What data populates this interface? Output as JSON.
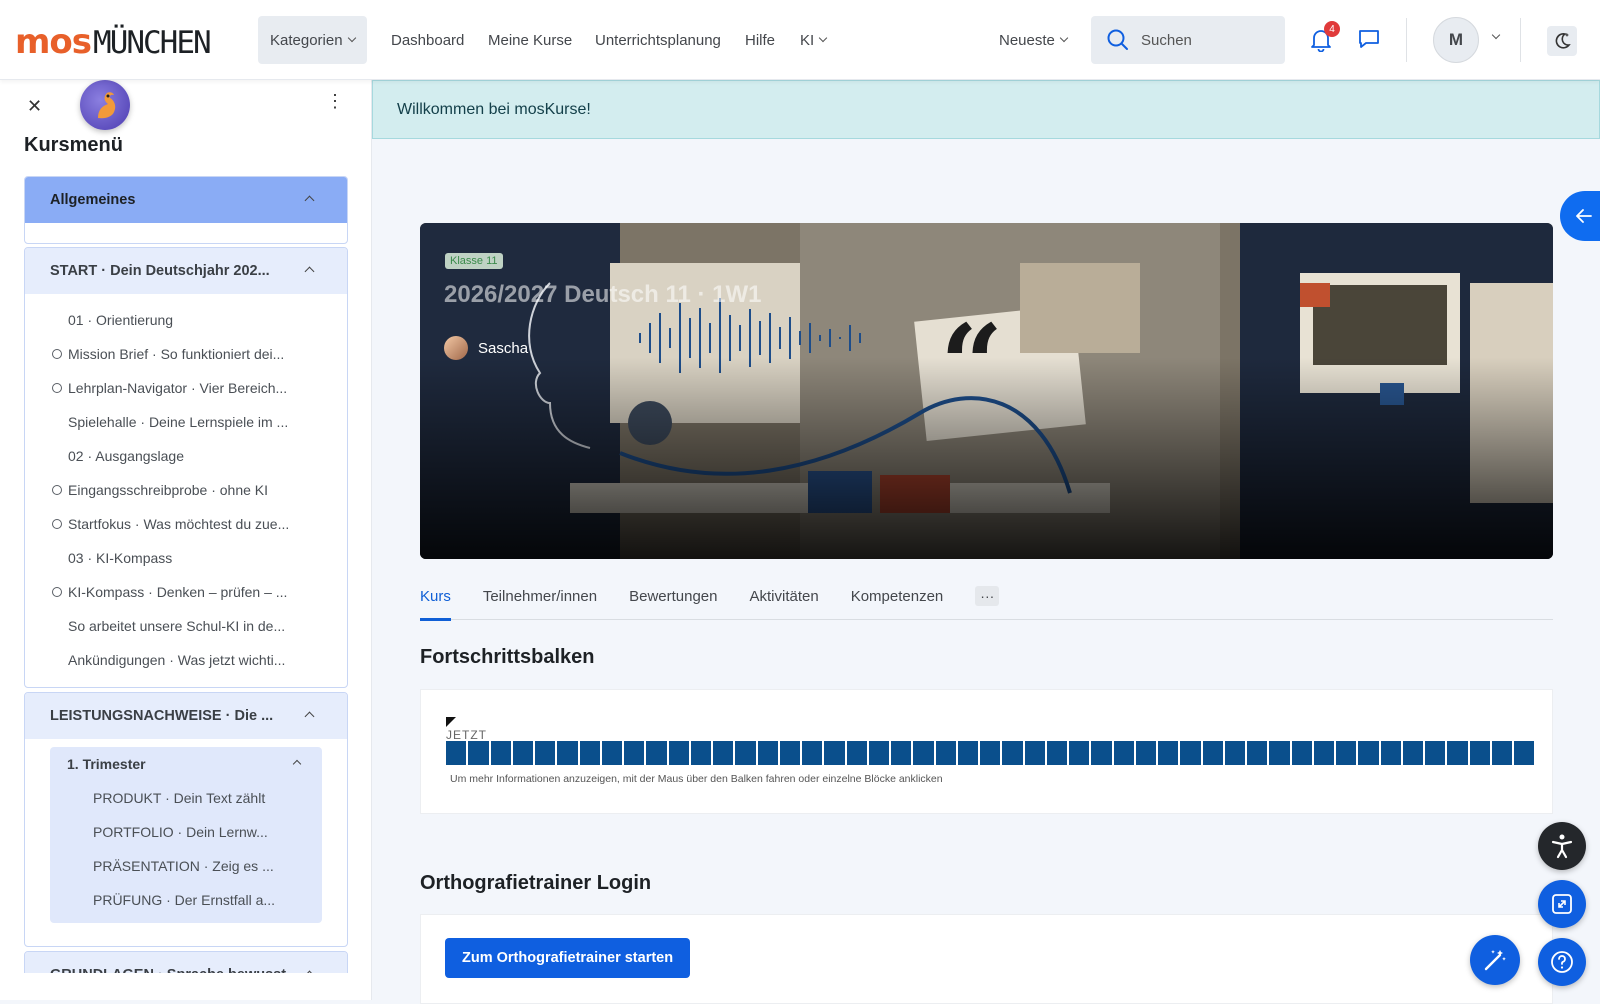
{
  "header": {
    "logo_mos": "mos",
    "logo_city": "MÜNCHEN",
    "nav": {
      "kategorien": "Kategorien",
      "dashboard": "Dashboard",
      "meine_kurse": "Meine Kurse",
      "unterrichtsplanung": "Unterrichtsplanung",
      "hilfe": "Hilfe",
      "ki": "KI"
    },
    "sort": "Neueste",
    "search_placeholder": "Suchen",
    "notification_count": "4",
    "avatar_initial": "M"
  },
  "drawer": {
    "title": "Kursmenü",
    "sections": [
      {
        "title": "Allgemeines",
        "items": []
      },
      {
        "title": "START · Dein Deutschjahr 202...",
        "items": [
          {
            "label": "01 · Orientierung",
            "circle": false
          },
          {
            "label": "Mission Brief · So funktioniert dei...",
            "circle": true
          },
          {
            "label": "Lehrplan-Navigator · Vier Bereich...",
            "circle": true
          },
          {
            "label": "Spielehalle · Deine Lernspiele im ...",
            "circle": false
          },
          {
            "label": "02 · Ausgangslage",
            "circle": false
          },
          {
            "label": "Eingangsschreibprobe · ohne KI",
            "circle": true
          },
          {
            "label": "Startfokus · Was möchtest du zue...",
            "circle": true
          },
          {
            "label": "03 · KI-Kompass",
            "circle": false
          },
          {
            "label": "KI-Kompass · Denken – prüfen – ...",
            "circle": true
          },
          {
            "label": "So arbeitet unsere Schul-KI in de...",
            "circle": false
          },
          {
            "label": "Ankündigungen · Was jetzt wichti...",
            "circle": false
          }
        ]
      },
      {
        "title": "LEISTUNGSNACHWEISE · Die ...",
        "subsection": {
          "title": "1. Trimester",
          "items": [
            "PRODUKT · Dein Text zählt",
            "PORTFOLIO · Dein Lernw...",
            "PRÄSENTATION · Zeig es ...",
            "PRÜFUNG · Der Ernstfall a..."
          ]
        }
      },
      {
        "title": "GRUNDLAGEN · Sprache bewusst ..."
      }
    ]
  },
  "alert": "Willkommen bei mosKurse!",
  "course": {
    "badge": "Klasse 11",
    "title": "2026/2027 Deutsch 11 · 1W1",
    "teacher": "Sascha"
  },
  "tabs": [
    "Kurs",
    "Teilnehmer/innen",
    "Bewertungen",
    "Aktivitäten",
    "Kompetenzen"
  ],
  "tab_more": "···",
  "progress": {
    "heading": "Fortschrittsbalken",
    "now_label": "JETZT",
    "block_count": 49,
    "info": "Um mehr Informationen anzuzeigen, mit der Maus über den Balken fahren oder einzelne Blöcke anklicken"
  },
  "orthografie": {
    "heading": "Orthografietrainer Login",
    "button": "Zum Orthografietrainer starten"
  },
  "colors": {
    "brand_orange": "#e8602a",
    "primary": "#0f5fe0",
    "progress_block": "#0a4f8c",
    "alert_bg": "#d3edef"
  }
}
